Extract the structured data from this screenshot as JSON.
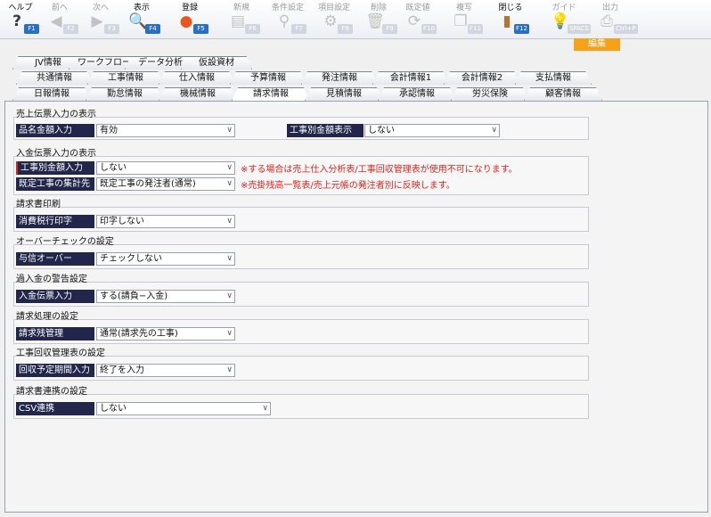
{
  "toolbar": {
    "buttons": [
      {
        "label": "ヘルプ",
        "key": "F1",
        "icon": "help-icon",
        "glyph": "?",
        "state": "act"
      },
      {
        "label": "前へ",
        "key": "F2",
        "icon": "arrow-left-icon",
        "glyph": "◀",
        "state": "dis"
      },
      {
        "label": "次へ",
        "key": "F3",
        "icon": "arrow-right-icon",
        "glyph": "▶",
        "state": "dis"
      },
      {
        "label": "表示",
        "key": "F4",
        "icon": "magnifier-icon",
        "glyph": "🔍",
        "state": "act"
      },
      {
        "label": "登録",
        "key": "F5",
        "icon": "ok-icon",
        "glyph": "●",
        "state": "act"
      },
      {
        "label": "新規",
        "key": "F6",
        "icon": "new-document-icon",
        "glyph": "▤",
        "state": "dis"
      },
      {
        "label": "条件設定",
        "key": "F7",
        "icon": "condition-search-icon",
        "glyph": "⚲",
        "state": "dis"
      },
      {
        "label": "項目設定",
        "key": "F8",
        "icon": "item-settings-icon",
        "glyph": "⚙",
        "state": "dis"
      },
      {
        "label": "削除",
        "key": "F9",
        "icon": "trash-icon",
        "glyph": "🗑",
        "state": "dis"
      },
      {
        "label": "既定値",
        "key": "F10",
        "icon": "default-value-icon",
        "glyph": "⟳",
        "state": "dis"
      },
      {
        "label": "複写",
        "key": "F11",
        "icon": "copy-icon",
        "glyph": "❐",
        "state": "dis"
      },
      {
        "label": "閉じる",
        "key": "F12",
        "icon": "close-door-icon",
        "glyph": "▮",
        "state": "act"
      },
      {
        "label": "ガイド",
        "key": "SPACE",
        "icon": "guide-bulb-icon",
        "glyph": "💡",
        "state": "dis"
      },
      {
        "label": "出力",
        "key": "Ctrl+P",
        "icon": "printer-icon",
        "glyph": "⎙",
        "state": "dis"
      }
    ],
    "edit_badge": "編集"
  },
  "tabs": {
    "row1": [
      "JV情報",
      "ワークフロー",
      "データ分析",
      "仮設資材"
    ],
    "row2": [
      "共通情報",
      "工事情報",
      "仕入情報",
      "予算情報",
      "発注情報",
      "会計情報1",
      "会計情報2",
      "支払情報"
    ],
    "row3": [
      "日報情報",
      "勤怠情報",
      "機械情報",
      "請求情報",
      "見積情報",
      "承認情報",
      "労災保険",
      "顧客情報"
    ],
    "selected_row3": "請求情報"
  },
  "sections": {
    "sales": {
      "title": "売上伝票入力の表示",
      "f1_label": "品名金額入力",
      "f1_value": "有効",
      "f2_label": "工事別金額表示",
      "f2_value": "しない"
    },
    "deposit": {
      "title": "入金伝票入力の表示",
      "f1_label": "工事別金額入力",
      "f1_value": "しない",
      "f1_note": "※する場合は売上仕入分析表/工事回収管理表が使用不可になります。",
      "f2_label": "既定工事の集計先",
      "f2_value": "既定工事の発注者(通常)",
      "f2_note": "※売掛残高一覧表/売上元帳の発注者別に反映します。"
    },
    "invoice_print": {
      "title": "請求書印刷",
      "label": "消費税行印字",
      "value": "印字しない"
    },
    "overcheck": {
      "title": "オーバーチェックの設定",
      "label": "与信オーバー",
      "value": "チェックしない"
    },
    "overpay": {
      "title": "過入金の警告設定",
      "label": "入金伝票入力",
      "value": "する(請負−入金)"
    },
    "billing": {
      "title": "請求処理の設定",
      "label": "請求残管理",
      "value": "通常(請求先の工事)"
    },
    "collection": {
      "title": "工事回収管理表の設定",
      "label": "回収予定期間入力",
      "value": "終了を入力"
    },
    "link": {
      "title": "請求書連携の設定",
      "label": "CSV連携",
      "value": "しない"
    }
  }
}
